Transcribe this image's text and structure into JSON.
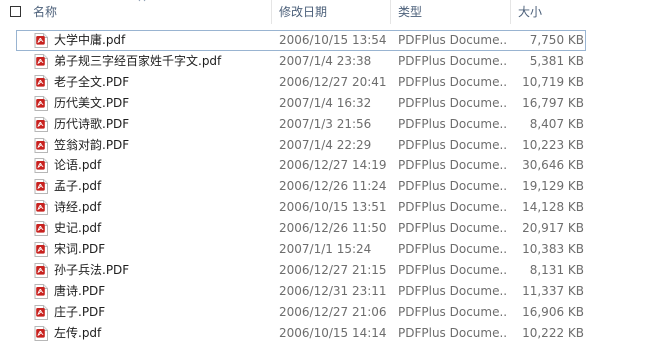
{
  "columns": {
    "name": "名称",
    "date": "修改日期",
    "type": "类型",
    "size": "大小"
  },
  "files": [
    {
      "name": "大学中庸.pdf",
      "date": "2006/10/15 13:54",
      "type": "PDFPlus Docume...",
      "size": "7,750 KB",
      "focused": true
    },
    {
      "name": "弟子规三字经百家姓千字文.pdf",
      "date": "2007/1/4 23:38",
      "type": "PDFPlus Docume...",
      "size": "5,381 KB"
    },
    {
      "name": "老子全文.PDF",
      "date": "2006/12/27 20:41",
      "type": "PDFPlus Docume...",
      "size": "10,719 KB"
    },
    {
      "name": "历代美文.PDF",
      "date": "2007/1/4 16:32",
      "type": "PDFPlus Docume...",
      "size": "16,797 KB"
    },
    {
      "name": "历代诗歌.PDF",
      "date": "2007/1/3 21:56",
      "type": "PDFPlus Docume...",
      "size": "8,407 KB"
    },
    {
      "name": "笠翁对韵.PDF",
      "date": "2007/1/4 22:29",
      "type": "PDFPlus Docume...",
      "size": "10,223 KB"
    },
    {
      "name": "论语.pdf",
      "date": "2006/12/27 14:19",
      "type": "PDFPlus Docume...",
      "size": "30,646 KB"
    },
    {
      "name": "孟子.pdf",
      "date": "2006/12/26 11:24",
      "type": "PDFPlus Docume...",
      "size": "19,129 KB"
    },
    {
      "name": "诗经.pdf",
      "date": "2006/10/15 13:51",
      "type": "PDFPlus Docume...",
      "size": "14,128 KB"
    },
    {
      "name": "史记.pdf",
      "date": "2006/12/26 11:50",
      "type": "PDFPlus Docume...",
      "size": "20,917 KB"
    },
    {
      "name": "宋词.PDF",
      "date": "2007/1/1 15:24",
      "type": "PDFPlus Docume...",
      "size": "10,383 KB"
    },
    {
      "name": "孙子兵法.PDF",
      "date": "2006/12/27 21:15",
      "type": "PDFPlus Docume...",
      "size": "8,131 KB"
    },
    {
      "name": "唐诗.PDF",
      "date": "2006/12/31 23:11",
      "type": "PDFPlus Docume...",
      "size": "11,337 KB"
    },
    {
      "name": "庄子.PDF",
      "date": "2006/12/27 21:06",
      "type": "PDFPlus Docume...",
      "size": "16,906 KB"
    },
    {
      "name": "左传.pdf",
      "date": "2006/10/15 14:14",
      "type": "PDFPlus Docume...",
      "size": "10,222 KB"
    }
  ],
  "colors": {
    "header_text": "#4c607a",
    "date_text": "#6d6d6d",
    "focus_border": "#99b4d1",
    "pdf_red": "#c8211e"
  },
  "icons": {
    "file": "pdf-file-icon",
    "sort": "chevron-up-icon"
  }
}
